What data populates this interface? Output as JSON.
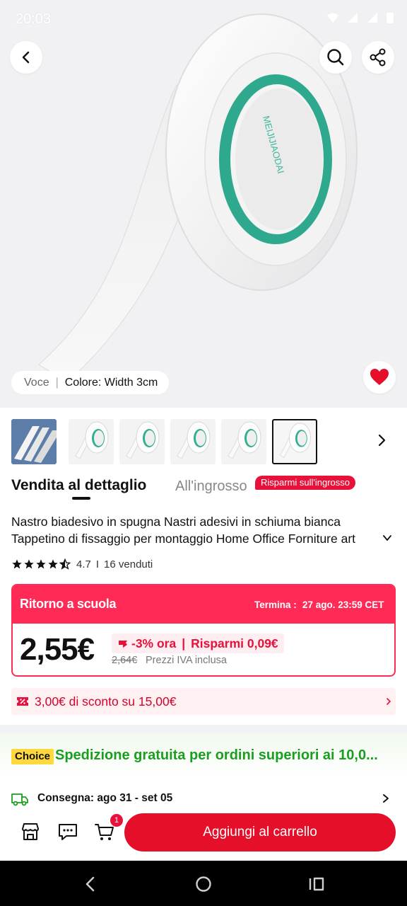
{
  "status_bar": {
    "time": "20:03",
    "icons": [
      "notification-icon",
      "wifi-icon",
      "signal-icon",
      "signal-icon",
      "battery-icon"
    ]
  },
  "hero": {
    "variant_label": "Voce",
    "variant_value": "Colore: Width 3cm",
    "tape_text": "MEIJIJIAODAI"
  },
  "thumbnails": {
    "count": 6,
    "selected_index": 5
  },
  "tabs": {
    "retail": "Vendita al dettaglio",
    "wholesale": "All'ingrosso",
    "wholesale_badge": "Risparmi sull'ingrosso"
  },
  "product": {
    "title": "Nastro biadesivo in spugna Nastri adesivi in schiuma bianca Tappetino di fissaggio per montaggio Home Office Forniture art",
    "rating": "4.7",
    "rating_stars": 4.7,
    "sold": "16 venduti"
  },
  "promo": {
    "title": "Ritorno a scuola",
    "ends_label": "Termina :",
    "ends_date": "27 ago. 23:59 CET",
    "price": "2,55€",
    "discount": "-3% ora",
    "savings": "Risparmi 0,09€",
    "old_price": "2,64€",
    "vat_note": "Prezzi IVA inclusa"
  },
  "coupon": {
    "text": "3,00€ di sconto su 15,00€"
  },
  "shipping": {
    "choice_badge": "Choice",
    "free_shipping": "Spedizione gratuita per ordini superiori ai 10,0...",
    "delivery": "Consegna: ago 31 - set 05"
  },
  "actions": {
    "cart_count": "1",
    "add_to_cart": "Aggiungi al carrello"
  },
  "colors": {
    "accent": "#e50f2a",
    "promo": "#ff2a55",
    "shipping_green": "#1b9e20",
    "choice_yellow": "#ffd83b"
  }
}
